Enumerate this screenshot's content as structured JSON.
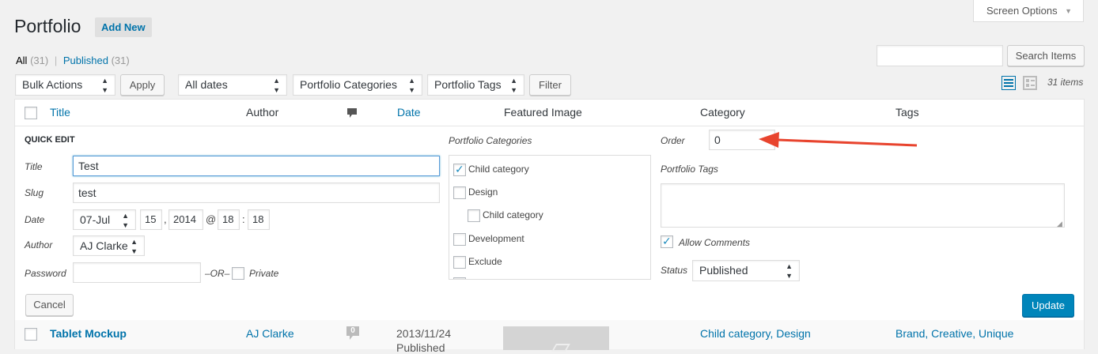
{
  "header": {
    "title": "Portfolio",
    "add_new": "Add New",
    "screen_options": "Screen Options"
  },
  "filters": {
    "all_label": "All",
    "all_count": "(31)",
    "separator": "|",
    "published_label": "Published",
    "published_count": "(31)",
    "bulk_actions": "Bulk Actions",
    "apply": "Apply",
    "dates": "All dates",
    "categories": "Portfolio Categories",
    "tags": "Portfolio Tags",
    "filter": "Filter",
    "search_button": "Search Items",
    "search_value": "",
    "items_count": "31 items"
  },
  "columns": {
    "title": "Title",
    "author": "Author",
    "date": "Date",
    "featured_image": "Featured Image",
    "category": "Category",
    "tags": "Tags"
  },
  "quick_edit": {
    "heading": "QUICK EDIT",
    "title_label": "Title",
    "title_value": "Test",
    "slug_label": "Slug",
    "slug_value": "test",
    "date_label": "Date",
    "month": "07-Jul",
    "day": "15",
    "comma": ",",
    "year": "2014",
    "at": "@",
    "hour": "18",
    "colon": ":",
    "minute": "18",
    "author_label": "Author",
    "author_value": "AJ Clarke",
    "password_label": "Password",
    "password_value": "",
    "or_label": "–OR–",
    "private_label": "Private",
    "categories_label": "Portfolio Categories",
    "categories": [
      {
        "label": "Child category",
        "checked": true
      },
      {
        "label": "Design",
        "checked": false
      },
      {
        "label": "Child category",
        "checked": false
      },
      {
        "label": "Development",
        "checked": false
      },
      {
        "label": "Exclude",
        "checked": false
      }
    ],
    "order_label": "Order",
    "order_value": "0",
    "tags_label": "Portfolio Tags",
    "tags_value": "",
    "allow_comments_label": "Allow Comments",
    "allow_comments": true,
    "status_label": "Status",
    "status_value": "Published",
    "cancel": "Cancel",
    "update": "Update"
  },
  "row": {
    "title": "Tablet Mockup",
    "author": "AJ Clarke",
    "comments": "0",
    "date": "2013/11/24",
    "status": "Published",
    "category_1": "Child category",
    "category_sep": ", ",
    "category_2": "Design",
    "tags": "Brand, Creative, Unique"
  },
  "colors": {
    "link": "#0073aa",
    "primary_button": "#0085ba",
    "arrow": "#e8442e",
    "background": "#f1f1f1"
  }
}
